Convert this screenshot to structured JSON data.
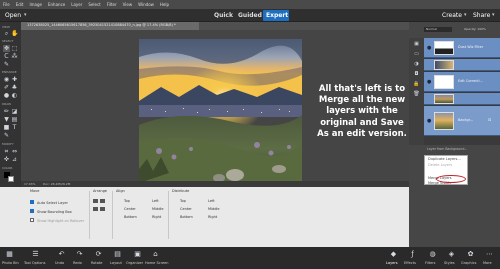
{
  "menubar": [
    "File",
    "Edit",
    "Image",
    "Enhance",
    "Layer",
    "Select",
    "Filter",
    "View",
    "Window",
    "Help"
  ],
  "modes": {
    "open": "Open",
    "quick": "Quick",
    "guided": "Guided",
    "expert": "Expert"
  },
  "create": "Create",
  "share": "Share",
  "document_tab": "1372638025_1446065615617856_3925041521410884470_n.jpg @ 17.4% (RGB/8) *",
  "tool_sections": [
    "VIEW",
    "SELECT",
    "ENHANCE",
    "DRAW",
    "MODIFY",
    "COLOR"
  ],
  "status": {
    "zoom": "17.43%",
    "doc": "Doc: 26.2M/26.2M"
  },
  "options": {
    "move_header": "Move",
    "auto_select": "Auto Select Layer",
    "bounding_box": "Show Bounding Box",
    "highlight": "Show Highlight on Rollover",
    "arrange_header": "Arrange",
    "align_header": "Align",
    "align_items": [
      "Top",
      "Center",
      "Bottom",
      "Left",
      "Middle",
      "Right"
    ],
    "distribute_header": "Distribute",
    "distribute_items": [
      "Top",
      "Center",
      "Bottom",
      "Left",
      "Middle",
      "Right"
    ]
  },
  "panel": {
    "tabs": [
      "Layers",
      "Effects",
      "Filters",
      "Styles",
      "Graphics"
    ],
    "blend": "Normal",
    "opacity": "Opacity: 100%"
  },
  "layers": [
    {
      "name": "Dust Wiz Filter"
    },
    {
      "name": "Edit Correcti..."
    },
    {
      "name": "Backgr..."
    }
  ],
  "context_menu": {
    "items": [
      "Layer from Background...",
      "Duplicate Layers...",
      "Delete Layers",
      "Merge Layers",
      "Merge Visible"
    ]
  },
  "message": "All that's left is to Merge all the new layers with the original and Save As an edit version.",
  "bottom_left": [
    "Photo Bin",
    "Tool Options",
    "Undo",
    "Redo",
    "Rotate",
    "Layout",
    "Organizer",
    "Home Screen"
  ],
  "bottom_right": [
    "Layers",
    "Effects",
    "Filters",
    "Styles",
    "Graphics",
    "More"
  ],
  "colors": {
    "accent": "#1e6fbf",
    "layer_selected": "#6b8fc2",
    "highlight_ring": "#c0202d"
  }
}
